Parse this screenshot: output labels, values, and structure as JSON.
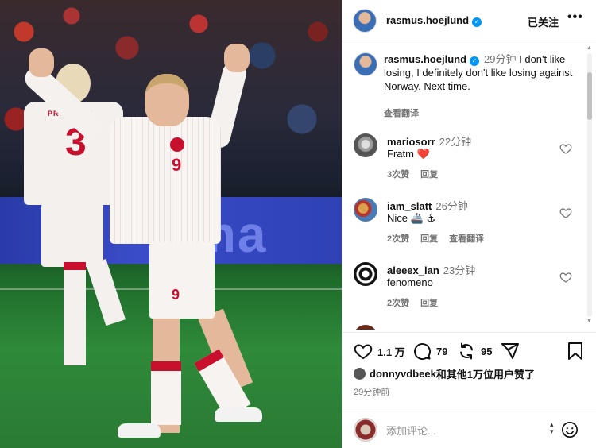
{
  "post": {
    "username": "rasmus.hoejlund",
    "verified_icon": "verified-badge-icon",
    "follow_label": "已关注",
    "more_label": "•••"
  },
  "photo": {
    "board_text": "ma",
    "back_player_name": "PROVSTGA",
    "back_player_number": "3",
    "main_player_number": "9"
  },
  "caption": {
    "username": "rasmus.hoejlund",
    "time": "29分钟",
    "text": "I don't like losing, I definitely don't like losing against Norway. Next time.",
    "translate_label": "查看翻译"
  },
  "comments": [
    {
      "username": "mariosorr",
      "time": "22分钟",
      "text": "Fratm",
      "emoji": "❤️",
      "likes": "3次赞",
      "reply": "回复",
      "translate": ""
    },
    {
      "username": "iam_slatt",
      "time": "26分钟",
      "text": "Nice",
      "emoji": "🚢 ⚓",
      "likes": "2次赞",
      "reply": "回复",
      "translate": "查看翻译"
    },
    {
      "username": "aleeex_lan",
      "time": "23分钟",
      "text": "fenomeno",
      "emoji": "",
      "likes": "2次赞",
      "reply": "回复",
      "translate": ""
    }
  ],
  "actions": {
    "likes": "1.1 万",
    "comments": "79",
    "reposts": "95",
    "liked_by_user": "donnyvdbeek",
    "liked_by_rest": "和其他1万位用户赞了",
    "post_time": "29分钟前"
  },
  "comment_box": {
    "placeholder": "添加评论..."
  },
  "colors": {
    "accent_blue": "#0095f6",
    "heart_red": "#e0245e",
    "muted": "#737373",
    "denmark_red": "#c8102e"
  }
}
